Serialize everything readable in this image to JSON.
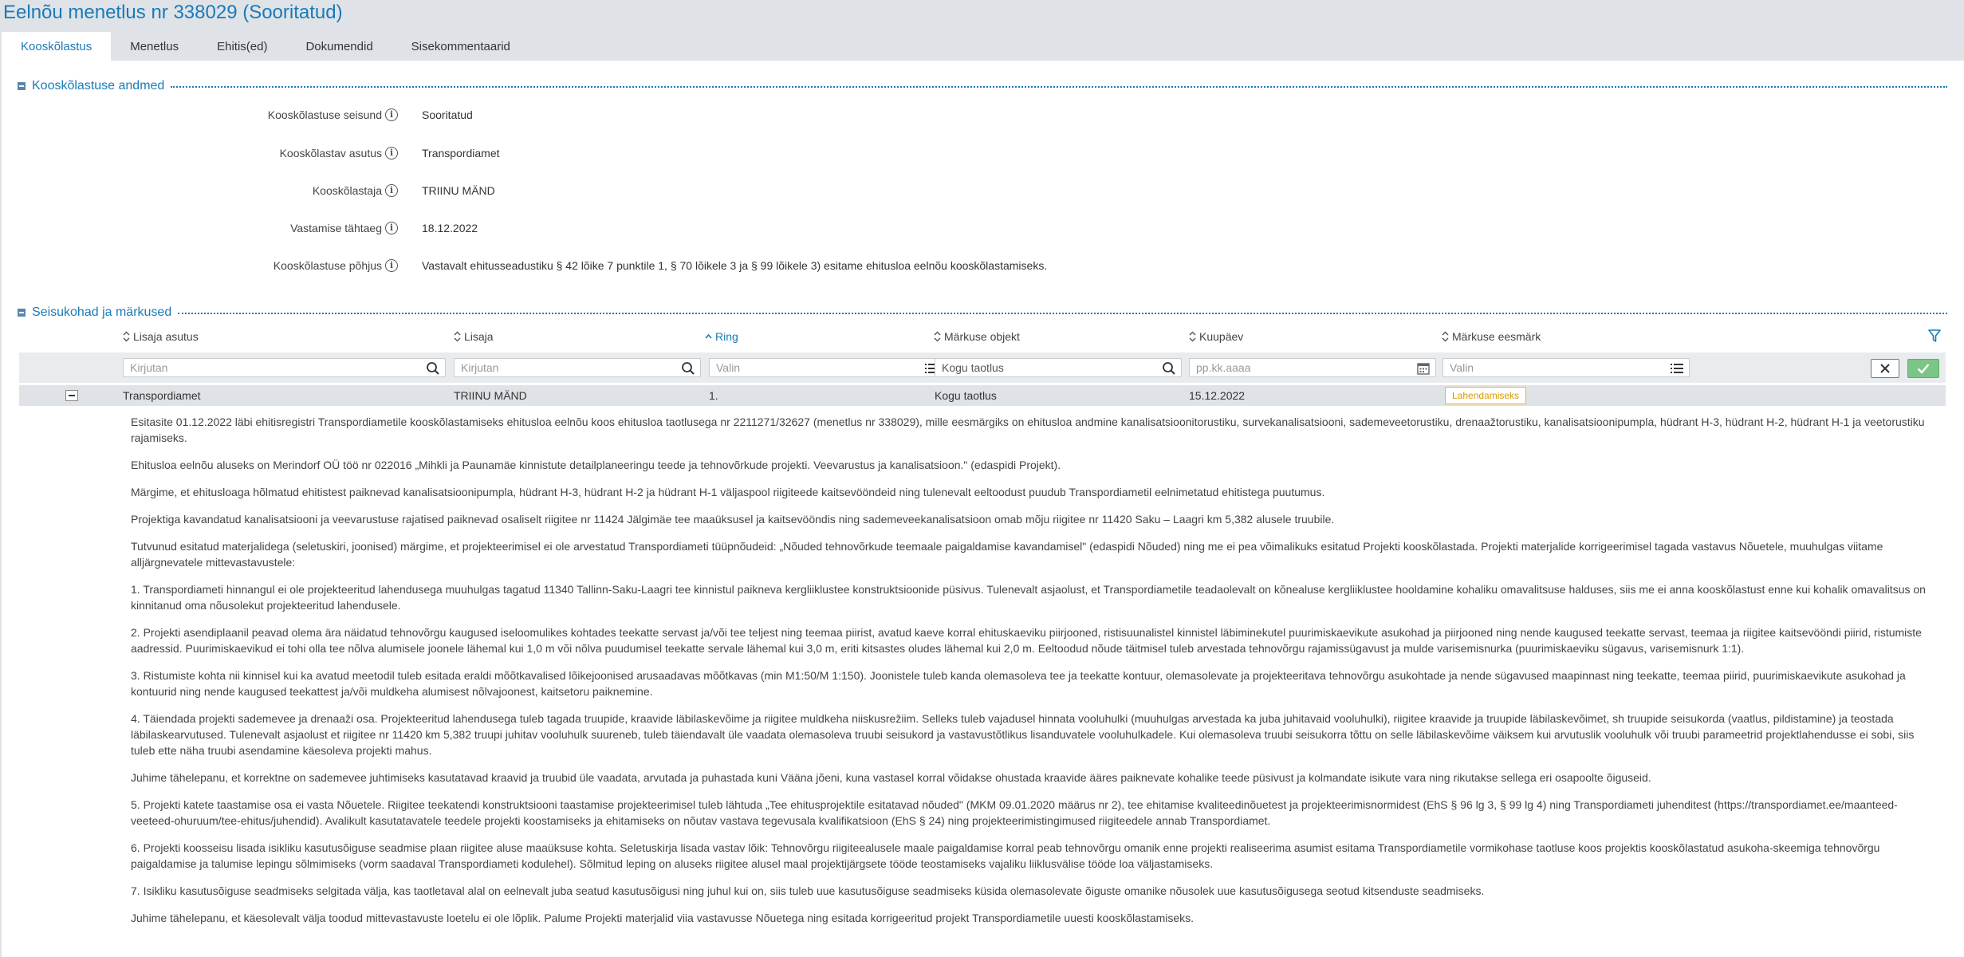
{
  "page": {
    "title": "Eelnõu menetlus nr 338029 (Sooritatud)"
  },
  "tabs": [
    {
      "label": "Kooskõlastus",
      "active": true
    },
    {
      "label": "Menetlus",
      "active": false
    },
    {
      "label": "Ehitis(ed)",
      "active": false
    },
    {
      "label": "Dokumendid",
      "active": false
    },
    {
      "label": "Sisekommentaarid",
      "active": false
    }
  ],
  "section_details": {
    "title": "Kooskõlastuse andmed",
    "fields": [
      {
        "label": "Kooskõlastuse seisund",
        "value": "Sooritatud"
      },
      {
        "label": "Kooskõlastav asutus",
        "value": "Transpordiamet"
      },
      {
        "label": "Kooskõlastaja",
        "value": "TRIINU MÄND"
      },
      {
        "label": "Vastamise tähtaeg",
        "value": "18.12.2022"
      },
      {
        "label": "Kooskõlastuse põhjus",
        "value": "Vastavalt ehitusseadustiku § 42 lõike 7 punktile 1, § 70 lõikele 3 ja § 99 lõikele 3) esitame ehitusloa eelnõu kooskõlastamiseks."
      }
    ]
  },
  "section_comments": {
    "title": "Seisukohad ja märkused",
    "columns": [
      {
        "label": "Lisaja asutus",
        "sort": "none"
      },
      {
        "label": "Lisaja",
        "sort": "none"
      },
      {
        "label": "Ring",
        "sort": "asc"
      },
      {
        "label": "Märkuse objekt",
        "sort": "none"
      },
      {
        "label": "Kuupäev",
        "sort": "none"
      },
      {
        "label": "Märkuse eesmärk",
        "sort": "none"
      }
    ],
    "filters": {
      "lisaja_asutus": {
        "placeholder": "Kirjutan",
        "value": ""
      },
      "lisaja": {
        "placeholder": "Kirjutan",
        "value": ""
      },
      "ring": {
        "placeholder": "Valin",
        "value": ""
      },
      "markuse_objekt": {
        "placeholder": "",
        "value": "Kogu taotlus"
      },
      "kuupaev": {
        "placeholder": "pp.kk.aaaa",
        "value": ""
      },
      "markuse_eesmark": {
        "placeholder": "Valin",
        "value": ""
      }
    },
    "row": {
      "lisaja_asutus": "Transpordiamet",
      "lisaja": "TRIINU MÄND",
      "ring": "1.",
      "markuse_objekt": "Kogu taotlus",
      "kuupaev": "15.12.2022",
      "eesmark": "Lahendamiseks"
    },
    "comment_paragraphs": [
      "Esitasite 01.12.2022 läbi ehitisregistri Transpordiametile kooskõlastamiseks ehitusloa eelnõu koos ehitusloa taotlusega nr 2211271/32627 (menetlus nr 338029), mille eesmärgiks on ehitusloa andmine kanalisatsioonitorustiku, survekanalisatsiooni, sademeveetorustiku, drenaažtorustiku, kanalisatsioonipumpla, hüdrant H-3, hüdrant H-2, hüdrant H-1 ja veetorustiku rajamiseks.",
      "Ehitusloa eelnõu aluseks on Merindorf OÜ töö nr 022016 „Mihkli ja Paunamäe kinnistute detailplaneeringu teede ja tehnovõrkude projekti. Veevarustus ja kanalisatsioon.\" (edaspidi Projekt).",
      "Märgime, et ehitusloaga hõlmatud ehitistest paiknevad kanalisatsioonipumpla, hüdrant H-3, hüdrant H-2 ja hüdrant H-1 väljaspool riigiteede kaitsevööndeid ning tulenevalt eeltoodust puudub Transpordiametil eelnimetatud ehitistega puutumus.",
      "Projektiga kavandatud kanalisatsiooni ja veevarustuse rajatised paiknevad osaliselt riigitee nr 11424 Jälgimäe tee maaüksusel ja kaitsevööndis ning sademeveekanalisatsioon omab mõju riigitee nr 11420 Saku – Laagri km 5,382 alusele truubile.",
      "Tutvunud esitatud materjalidega (seletuskiri, joonised) märgime, et projekteerimisel ei ole arvestatud Transpordiameti tüüpnõudeid: „Nõuded tehnovõrkude teemaale paigaldamise kavandamisel\" (edaspidi Nõuded) ning me ei pea võimalikuks esitatud Projekti kooskõlastada. Projekti materjalide korrigeerimisel tagada vastavus Nõuetele, muuhulgas viitame alljärgnevatele mittevastavustele:",
      "1. Transpordiameti hinnangul ei ole projekteeritud lahendusega muuhulgas tagatud 11340 Tallinn-Saku-Laagri tee kinnistul paikneva kergliiklustee konstruktsioonide püsivus. Tulenevalt asjaolust, et Transpordiametile teadaolevalt on kõnealuse kergliiklustee hooldamine kohaliku omavalitsuse halduses, siis me ei anna kooskõlastust enne kui kohalik omavalitsus on kinnitanud oma nõusolekut projekteeritud lahendusele.",
      "2. Projekti asendiplaanil peavad olema ära näidatud tehnovõrgu kaugused iseloomulikes kohtades teekatte servast ja/või tee teljest ning teemaa piirist, avatud kaeve korral ehituskaeviku piirjooned, ristisuunalistel kinnistel läbiminekutel puurimiskaevikute asukohad ja piirjooned ning nende kaugused teekatte servast, teemaa ja riigitee kaitsevööndi piirid, ristumiste aadressid. Puurimiskaevikud ei tohi olla tee nõlva alumisele joonele lähemal kui 1,0 m või nõlva puudumisel teekatte servale lähemal kui 3,0 m, eriti kitsastes oludes lähemal kui 2,0 m. Eeltoodud nõude täitmisel tuleb arvestada tehnovõrgu rajamissügavust ja mulde varisemisnurka (puurimiskaeviku sügavus, varisemisnurk 1:1).",
      "3. Ristumiste kohta nii kinnisel kui ka avatud meetodil tuleb esitada eraldi mõõtkavalised lõikejoonised arusaadavas mõõtkavas (min M1:50/M 1:150). Joonistele tuleb kanda olemasoleva tee ja teekatte kontuur, olemasolevate ja projekteeritava tehnovõrgu asukohtade ja nende sügavused maapinnast ning teekatte, teemaa piirid, puurimiskaevikute asukohad ja kontuurid ning nende kaugused teekattest ja/või muldkeha alumisest nõlvajoonest, kaitsetoru paiknemine.",
      "4. Täiendada projekti sademevee ja drenaaži osa. Projekteeritud lahendusega tuleb tagada truupide, kraavide läbilaskevõime ja riigitee muldkeha niiskusrežiim. Selleks tuleb vajadusel hinnata vooluhulki (muuhulgas arvestada ka juba juhitavaid vooluhulki), riigitee kraavide ja truupide läbilaskevõimet, sh truupide seisukorda (vaatlus, pildistamine) ja teostada läbilaskearvutused. Tulenevalt asjaolust et riigitee nr 11420 km 5,382 truupi juhitav vooluhulk suureneb, tuleb täiendavalt üle vaadata olemasoleva truubi seisukord ja vastavustõtlikus lisanduvatele vooluhulkadele. Kui olemasoleva truubi seisukorra tõttu on selle läbilaskevõime väiksem kui arvutuslik vooluhulk või truubi parameetrid projektlahendusse ei sobi, siis tuleb ette näha truubi asendamine käesoleva projekti mahus.",
      "Juhime tähelepanu, et korrektne on sademevee juhtimiseks kasutatavad kraavid ja truubid üle vaadata, arvutada ja puhastada kuni Vääna jõeni, kuna vastasel korral võidakse ohustada kraavide ääres paiknevate kohalike teede püsivust ja kolmandate isikute vara ning rikutakse sellega eri osapoolte õiguseid.",
      "5. Projekti katete taastamise osa ei vasta Nõuetele. Riigitee teekatendi konstruktsiooni taastamise projekteerimisel tuleb lähtuda „Tee ehitusprojektile esitatavad nõuded\" (MKM 09.01.2020 määrus nr 2), tee ehitamise kvaliteedinõuetest ja projekteerimisnormidest (EhS § 96 lg 3, § 99 lg 4) ning Transpordiameti juhenditest (https://transpordiamet.ee/maanteed-veeteed-ohuruum/tee-ehitus/juhendid). Avalikult kasutatavatele teedele projekti koostamiseks ja ehitamiseks on nõutav vastava tegevusala kvalifikatsioon (EhS § 24) ning projekteerimistingimused riigiteedele annab Transpordiamet.",
      "6. Projekti koosseisu lisada isikliku kasutusõiguse seadmise plaan riigitee aluse maaüksuse kohta. Seletuskirja lisada vastav lõik: Tehnovõrgu riigiteealusele maale paigaldamise korral peab tehnovõrgu omanik enne projekti realiseerima asumist esitama Transpordiametile vormikohase taotluse koos projektis kooskõlastatud asukoha-skeemiga tehnovõrgu paigaldamise ja talumise lepingu sõlmimiseks (vorm saadaval Transpordiameti kodulehel). Sõlmitud leping on aluseks riigitee alusel maal projektijärgsete tööde teostamiseks vajaliku liiklusvälise tööde loa väljastamiseks.",
      "7. Isikliku kasutusõiguse seadmiseks selgitada välja, kas taotletaval alal on eelnevalt juba seatud kasutusõigusi ning juhul kui on, siis tuleb uue kasutusõiguse seadmiseks küsida olemasolevate õiguste omanike nõusolek uue kasutusõigusega seotud kitsenduste seadmiseks.",
      "Juhime tähelepanu, et käesolevalt välja toodud mittevastavuste loetelu ei ole lõplik. Palume Projekti materjalid viia vastavusse Nõuetega ning esitada korrigeeritud projekt Transpordiametile uuesti kooskõlastamiseks."
    ]
  },
  "colors": {
    "accent": "#1a7ab8",
    "badge_border": "#f5b800",
    "confirm_green": "#7bc586"
  }
}
